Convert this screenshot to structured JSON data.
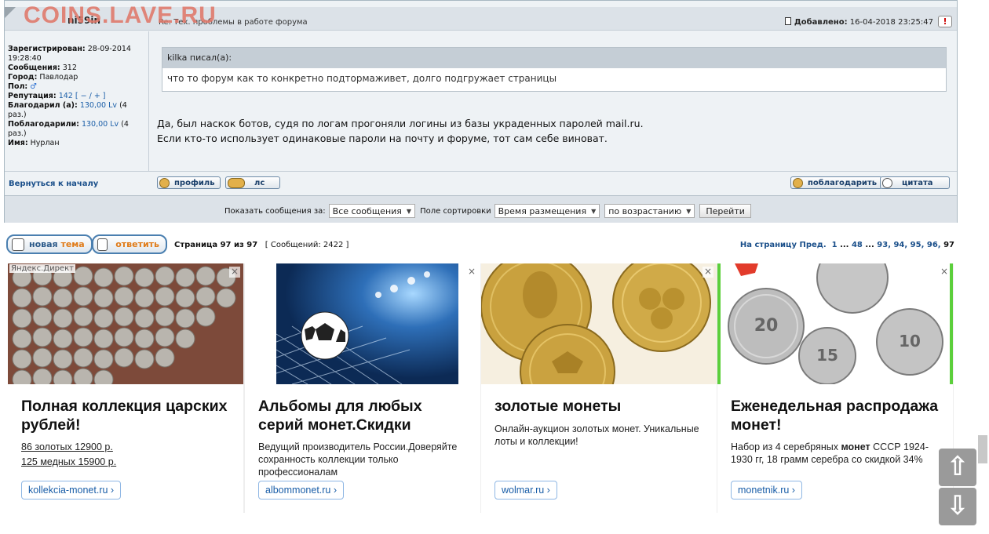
{
  "watermark": "COINS.LAVE.RU",
  "post": {
    "author": "ni59in",
    "subject": "Re: Тех. проблемы в работе форума",
    "added_label": "Добавлено:",
    "added_value": "16-04-2018 23:25:47",
    "report": "!",
    "userinfo": {
      "registered_label": "Зарегистрирован:",
      "registered_value": "28-09-2014 19:28:40",
      "messages_label": "Сообщения:",
      "messages_value": "312",
      "city_label": "Город:",
      "city_value": "Павлодар",
      "gender_label": "Пол:",
      "gender_icon": "♂",
      "reputation_label": "Репутация:",
      "reputation_value": "142",
      "reputation_controls": "[ − / + ]",
      "thanked_label": "Благодарил (а):",
      "thanked_value": "130,00 Lv",
      "thanked_count": "(4 раз.)",
      "got_thanks_label": "Поблагодарили:",
      "got_thanks_value": "130,00 Lv",
      "got_thanks_count": "(4 раз.)",
      "name_label": "Имя:",
      "name_value": "Нурлан"
    },
    "quote_author": "kilka писал(а):",
    "quote_text": "что то форум как то конкретно подтормаживет, долго подгружает страницы",
    "text_line1": "Да, был наскок ботов, судя по логам прогоняли логины из базы украденных паролей mail.ru.",
    "text_line2": "Если кто-то использует одинаковые пароли на почту и форуме, тот сам себе виноват.",
    "back_link": "Вернуться к началу",
    "btn_profile": "профиль",
    "btn_pm": "лс",
    "btn_thank": "поблагодарить",
    "btn_quote": "цитата"
  },
  "sortbar": {
    "show_label": "Показать сообщения за:",
    "show_value": "Все сообщения",
    "sort_label": "Поле сортировки",
    "sort_value": "Время размещения",
    "order_value": "по возрастанию",
    "go": "Перейти"
  },
  "pager": {
    "new_topic_1": "новая",
    "new_topic_2": "тема",
    "reply": "ответить",
    "page_label": "Страница 97 из 97",
    "messages_prefix": "[ Сообщений:",
    "messages_count": "2422",
    "messages_suffix": "]",
    "goto_label": "На страницу",
    "prev": "Пред.",
    "p1": "1",
    "dots1": "...",
    "p48": "48",
    "dots2": "...",
    "p93": "93",
    "p94": "94",
    "p95": "95",
    "p96": "96",
    "p97": "97"
  },
  "ads": [
    {
      "label": "Яндекс.Директ",
      "title": "Полная коллекция царских рублей!",
      "line1": "86 золотых 12900 р.",
      "line2": "125 медных 15900 р.",
      "url": "kollekcia-monet.ru ›"
    },
    {
      "title": "Альбомы для любых серий монет.Скидки",
      "text": "Ведущий производитель России.Доверяйте сохранность коллекции только профессионалам",
      "url": "albommonet.ru ›"
    },
    {
      "title": "золотые монеты",
      "text_a": "Онлайн-аукцион",
      "text_b": "золотых монет",
      "text_c": ". Уникальные лоты и коллекции!",
      "url": "wolmar.ru ›"
    },
    {
      "title": "Еженедельная распродажа монет!",
      "text_a": "Набор из 4 серебряных",
      "text_b": "монет",
      "text_c": "СССР 1924-1930 гг, 18 грамм серебра со скидкой 34%",
      "url": "monetnik.ru ›"
    }
  ],
  "close_glyph": "×",
  "scroll_up": "⇧",
  "scroll_down": "⇩"
}
